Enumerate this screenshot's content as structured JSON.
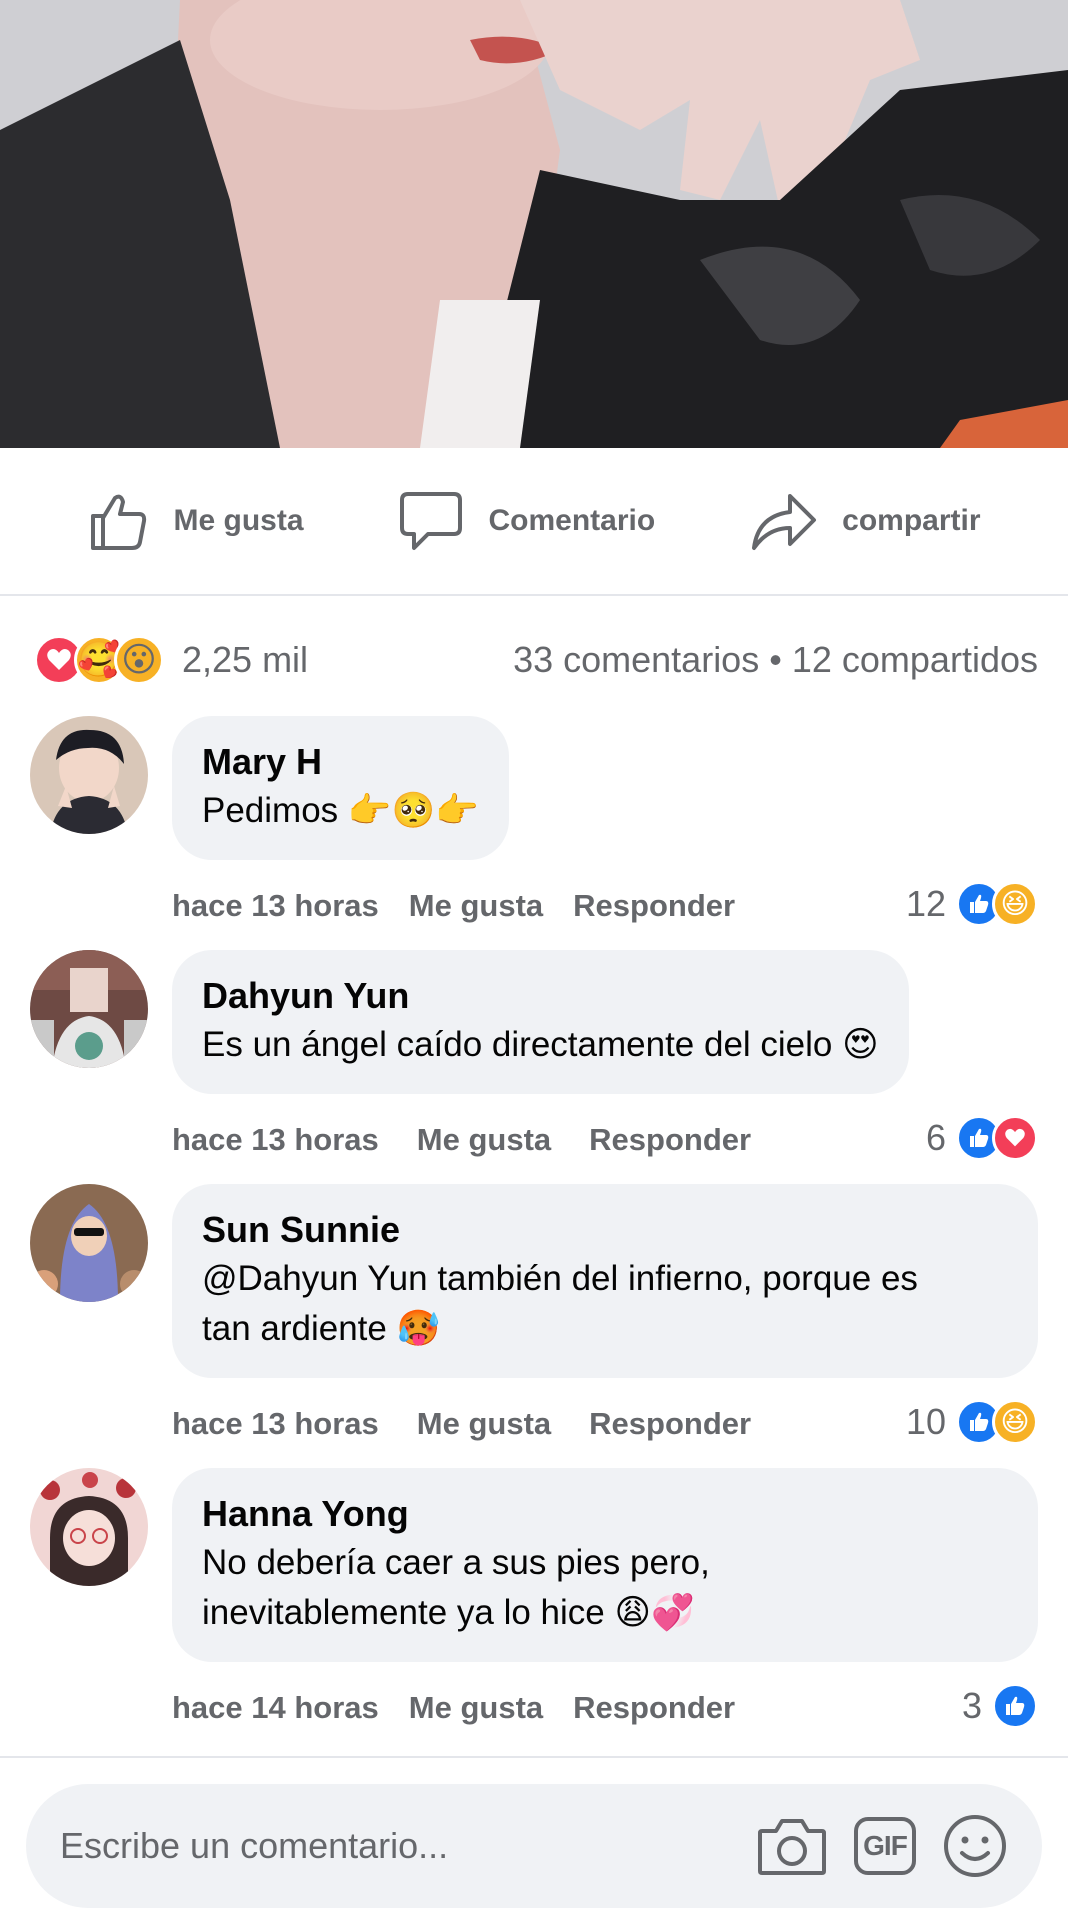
{
  "actions": {
    "like": "Me gusta",
    "comment": "Comentario",
    "share": "compartir"
  },
  "summary": {
    "reaction_icons": [
      "love-icon",
      "care-icon",
      "wow-icon"
    ],
    "reaction_count": "2,25 mil",
    "comments_count": "33 comentarios",
    "separator": "•",
    "shares_count": "12 compartidos"
  },
  "comments": [
    {
      "author": "Mary H",
      "text": "Pedimos 👉🥺👉",
      "time": "hace 13 horas",
      "like_label": "Me gusta",
      "reply_label": "Responder",
      "reaction_count": "12",
      "reaction_icons": [
        "like-icon",
        "haha-icon"
      ]
    },
    {
      "author": "Dahyun Yun",
      "text": "Es un ángel caído directamente del cielo 😍",
      "time": "hace 13 horas",
      "like_label": "Me gusta",
      "reply_label": "Responder",
      "reaction_count": "6",
      "reaction_icons": [
        "like-icon",
        "love-icon"
      ]
    },
    {
      "author": "Sun Sunnie",
      "text_line1": "@Dahyun Yun también del infierno, porque es",
      "text_line2": "tan ardiente 🥵",
      "time": "hace 13 horas",
      "like_label": "Me gusta",
      "reply_label": "Responder",
      "reaction_count": "10",
      "reaction_icons": [
        "like-icon",
        "haha-icon"
      ]
    },
    {
      "author": "Hanna Yong",
      "text_line1": "No debería caer a sus pies pero,",
      "text_line2": "inevitablemente ya lo hice 😩💞",
      "time": "hace 14 horas",
      "like_label": "Me gusta",
      "reply_label": "Responder",
      "reaction_count": "3",
      "reaction_icons": [
        "like-icon"
      ]
    }
  ],
  "composer": {
    "placeholder": "Escribe un comentario...",
    "gif_label": "GIF",
    "tools": [
      "camera-icon",
      "gif-icon",
      "emoji-icon"
    ]
  },
  "colors": {
    "secondary_text": "#65676b",
    "bubble": "#f0f2f5",
    "like_blue": "#1877f2",
    "love_red": "#f33e58",
    "emoji_yellow": "#f7b125"
  }
}
